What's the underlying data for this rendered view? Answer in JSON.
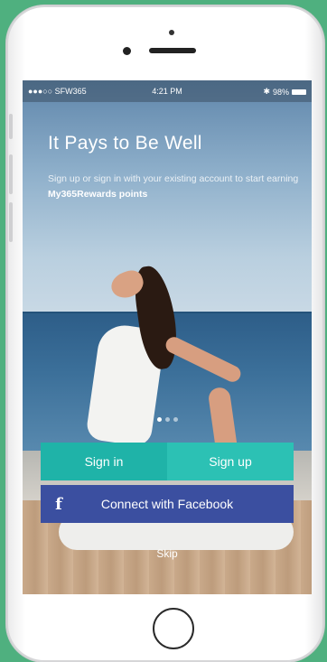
{
  "status_bar": {
    "carrier": "●●●○○ SFW365",
    "time": "4:21 PM",
    "battery": "98%"
  },
  "hero": {
    "title": "It Pays to Be Well",
    "subtitle_prefix": "Sign up or sign in with your existing account to start earning ",
    "subtitle_emphasis": "My365Rewards points"
  },
  "pager": {
    "count": 3,
    "active_index": 0
  },
  "buttons": {
    "sign_in": "Sign in",
    "sign_up": "Sign up",
    "facebook": "Connect with Facebook",
    "skip": "Skip"
  },
  "colors": {
    "sign_in": "#1fb3a8",
    "sign_up": "#2cc1b4",
    "facebook": "#3b4fa0",
    "background": "#4fb07f"
  },
  "icons": {
    "facebook": "facebook-icon",
    "wifi": "wifi-icon",
    "bluetooth": "bluetooth-icon",
    "battery": "battery-icon"
  }
}
